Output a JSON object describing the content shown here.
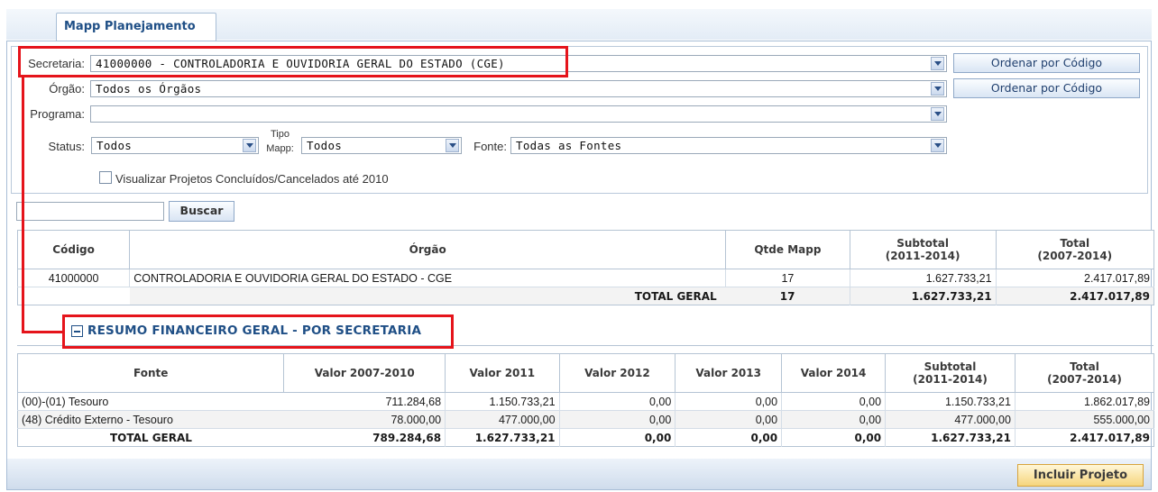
{
  "tab": {
    "label": "Mapp Planejamento"
  },
  "filters": {
    "secretaria_label": "Secretaria:",
    "secretaria_value": "41000000 - CONTROLADORIA E OUVIDORIA GERAL DO ESTADO (CGE)",
    "orgao_label": "Órgão:",
    "orgao_value": "Todos os Órgãos",
    "programa_label": "Programa:",
    "programa_value": "",
    "status_label": "Status:",
    "status_value": "Todos",
    "tipo_label_1": "Tipo",
    "tipo_label_2": "Mapp:",
    "tipo_value": "Todos",
    "fonte_label": "Fonte:",
    "fonte_value": "Todas as Fontes",
    "ordenar_label": "Ordenar por Código",
    "checkbox_label": "Visualizar Projetos Concluídos/Cancelados até 2010",
    "search_value": "",
    "buscar_label": "Buscar"
  },
  "table1": {
    "headers": [
      "Código",
      "Órgão",
      "Qtde Mapp",
      "Subtotal",
      "(2011-2014)",
      "Total",
      "(2007-2014)"
    ],
    "rows": [
      [
        "41000000",
        "CONTROLADORIA E OUVIDORIA GERAL DO ESTADO - CGE",
        "17",
        "1.627.733,21",
        "2.417.017,89"
      ]
    ],
    "total": [
      "TOTAL GERAL",
      "17",
      "1.627.733,21",
      "2.417.017,89"
    ]
  },
  "section": {
    "title": "RESUMO FINANCEIRO GERAL - POR SECRETARIA"
  },
  "table2": {
    "headers": [
      "Fonte",
      "Valor 2007-2010",
      "Valor 2011",
      "Valor 2012",
      "Valor 2013",
      "Valor 2014",
      "Subtotal",
      "(2011-2014)",
      "Total",
      "(2007-2014)"
    ],
    "rows": [
      [
        "(00)-(01) Tesouro",
        "711.284,68",
        "1.150.733,21",
        "0,00",
        "0,00",
        "0,00",
        "1.150.733,21",
        "1.862.017,89"
      ],
      [
        "(48) Crédito Externo - Tesouro",
        "78.000,00",
        "477.000,00",
        "0,00",
        "0,00",
        "0,00",
        "477.000,00",
        "555.000,00"
      ]
    ],
    "total": [
      "TOTAL GERAL",
      "789.284,68",
      "1.627.733,21",
      "0,00",
      "0,00",
      "0,00",
      "1.627.733,21",
      "2.417.017,89"
    ]
  },
  "footer": {
    "incluir_label": "Incluir Projeto"
  },
  "colors": {
    "highlight": "#e5141b",
    "accent": "#1f4f86"
  }
}
